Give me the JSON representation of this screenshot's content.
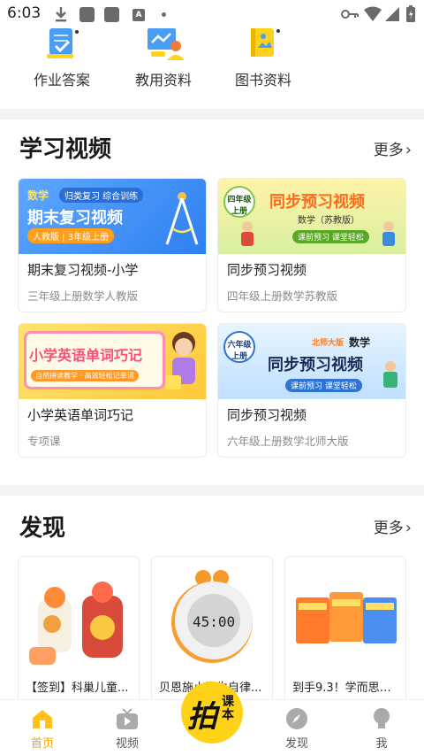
{
  "status_bar": {
    "time": "6:03",
    "a_badge": "A"
  },
  "shortcuts": [
    {
      "label": "作业答案",
      "icon": "homework-answer-icon"
    },
    {
      "label": "教用资料",
      "icon": "teaching-material-icon"
    },
    {
      "label": "图书资料",
      "icon": "book-material-icon"
    }
  ],
  "videos": {
    "title": "学习视频",
    "more": "更多",
    "cards": [
      {
        "title": "期末复习视频-小学",
        "subtitle": "三年级上册数学人教版",
        "thumb": {
          "tag": "数学",
          "banner": "归类复习 综合训练",
          "headline": "期末复习视频",
          "pill": "人教版 | 3年级上册"
        }
      },
      {
        "title": "同步预习视频",
        "subtitle": "四年级上册数学苏教版",
        "thumb": {
          "badge_line1": "四年级",
          "badge_line2": "上册",
          "headline": "同步预习视频",
          "subject": "数学（苏教版）",
          "pill": "课前预习 课堂轻松"
        }
      },
      {
        "title": "小学英语单词巧记",
        "subtitle": "专项课",
        "thumb": {
          "headline": "小学英语单词巧记",
          "pill": "自然拼读教学 · 高效轻松记单词"
        }
      },
      {
        "title": "同步预习视频",
        "subtitle": "六年级上册数学北师大版",
        "thumb": {
          "badge_line1": "六年级",
          "badge_line2": "上册",
          "edition": "北师大版",
          "subject": "数学",
          "headline": "同步预习视频",
          "pill": "课前预习 课堂轻松"
        }
      }
    ]
  },
  "discover": {
    "title": "发现",
    "more": "更多",
    "cards": [
      {
        "title": "【签到】科巢儿童..."
      },
      {
        "title": "贝恩施小学生自律...",
        "clock_text": "45:00"
      },
      {
        "title": "到手9.3！学而思新..."
      }
    ]
  },
  "bottom_nav": {
    "items": [
      {
        "label": "首页",
        "active": true
      },
      {
        "label": "视频",
        "active": false
      },
      {
        "label": "发现",
        "active": false
      },
      {
        "label": "我",
        "active": false
      }
    ],
    "center": {
      "big": "拍",
      "small": "课本"
    }
  },
  "colors": {
    "accent": "#f5a500",
    "brand_yellow": "#ffd21a"
  }
}
